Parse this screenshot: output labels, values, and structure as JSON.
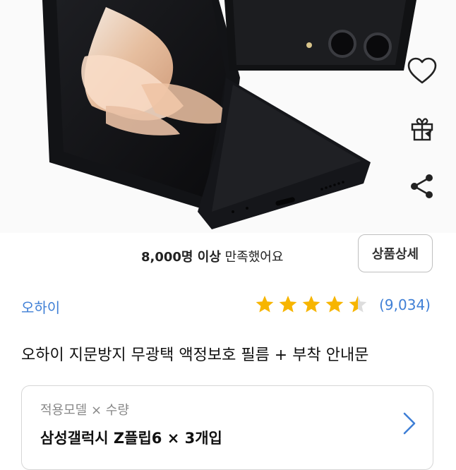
{
  "satisfaction": {
    "count": "8,000명 이상",
    "suffix": " 만족했어요"
  },
  "detail_button": "상품상세",
  "brand": "오하이",
  "rating": {
    "value": 4.5,
    "count": "(9,034)"
  },
  "product_title": "오하이 지문방지 무광택 액정보호 필름 + 부착 안내문",
  "option": {
    "label": "적용모델 × 수량",
    "value": "삼성갤럭시 Z플립6 × 3개입"
  },
  "colors": {
    "accent": "#3f7fd6",
    "star": "#f7b500"
  },
  "icons": [
    "heart-icon",
    "gift-icon",
    "share-icon",
    "chevron-right-icon"
  ]
}
